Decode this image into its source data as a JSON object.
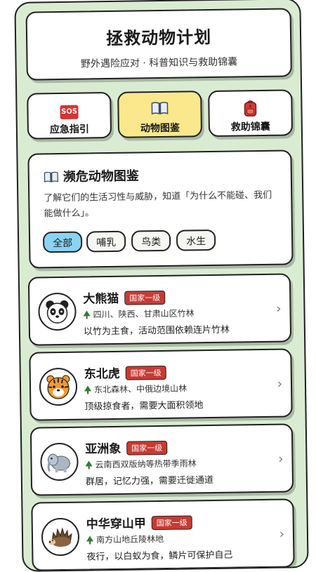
{
  "header": {
    "title": "拯救动物计划",
    "subtitle": "野外遇险应对 · 科普知识与救助锦囊"
  },
  "tabs": [
    {
      "label": "应急指引",
      "icon": "sos-icon",
      "icon_text": "SOS",
      "active": false
    },
    {
      "label": "动物图鉴",
      "icon": "book-icon",
      "active": true
    },
    {
      "label": "救助锦囊",
      "icon": "backpack-icon",
      "active": false
    }
  ],
  "intro": {
    "title": "濒危动物图鉴",
    "text": "了解它们的生活习性与威胁，知道「为什么不能碰、我们能做什么」。"
  },
  "filters": [
    {
      "label": "全部",
      "active": true
    },
    {
      "label": "哺乳",
      "active": false
    },
    {
      "label": "鸟类",
      "active": false
    },
    {
      "label": "水生",
      "active": false
    }
  ],
  "animals": [
    {
      "name": "大熊猫",
      "badge": "国家一级",
      "location": "四川、陕西、甘肃山区竹林",
      "desc": "以竹为主食，活动范围依赖连片竹林",
      "icon": "panda-icon"
    },
    {
      "name": "东北虎",
      "badge": "国家一级",
      "location": "东北森林、中俄边境山林",
      "desc": "顶级掠食者，需要大面积领地",
      "icon": "tiger-icon"
    },
    {
      "name": "亚洲象",
      "badge": "国家一级",
      "location": "云南西双版纳等热带季雨林",
      "desc": "群居，记忆力强，需要迁徙通道",
      "icon": "elephant-icon"
    },
    {
      "name": "中华穿山甲",
      "badge": "国家一级",
      "location": "南方山地丘陵林地",
      "desc": "夜行，以白蚁为食，鳞片可保护自己",
      "icon": "hedgehog-icon"
    }
  ],
  "colors": {
    "background": "#d9ecd2",
    "active_tab": "#fbe88c",
    "active_chip": "#8ad3f3",
    "badge": "#c73b33"
  }
}
